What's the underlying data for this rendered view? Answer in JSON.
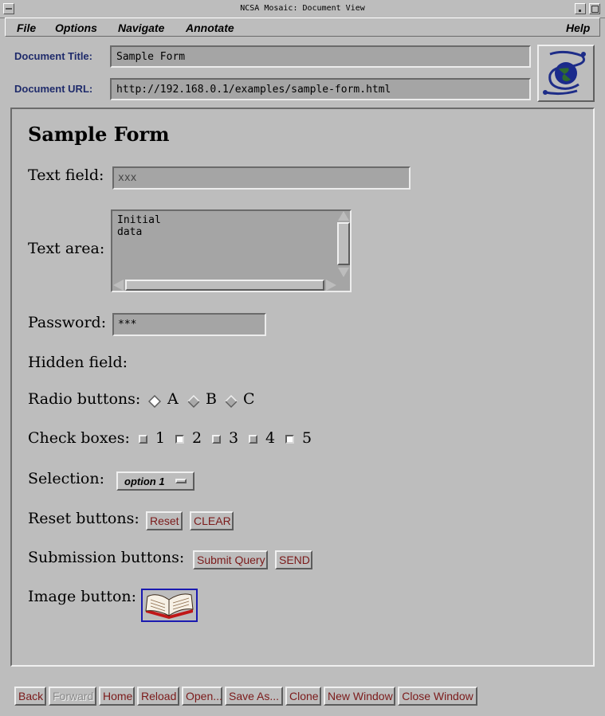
{
  "window": {
    "title": "NCSA Mosaic: Document View"
  },
  "menu": {
    "file": "File",
    "options": "Options",
    "navigate": "Navigate",
    "annotate": "Annotate",
    "help": "Help"
  },
  "doc": {
    "title_label": "Document Title:",
    "title_value": "Sample Form",
    "url_label": "Document URL:",
    "url_value": "http://192.168.0.1/examples/sample-form.html"
  },
  "page": {
    "heading": "Sample Form",
    "text_field": {
      "label": "Text field:",
      "value": "xxx"
    },
    "text_area": {
      "label": "Text area:",
      "line1": "Initial",
      "line2": "data"
    },
    "password": {
      "label": "Password:",
      "value": "***"
    },
    "hidden": {
      "label": "Hidden field:"
    },
    "radio": {
      "label": "Radio buttons:",
      "options": [
        "A",
        "B",
        "C"
      ],
      "selected": "A"
    },
    "checkboxes": {
      "label": "Check boxes:",
      "options": [
        "1",
        "2",
        "3",
        "4",
        "5"
      ],
      "checked": [
        "2",
        "5"
      ]
    },
    "selection": {
      "label": "Selection:",
      "value": "option 1"
    },
    "reset": {
      "label": "Reset buttons:",
      "buttons": [
        "Reset",
        "CLEAR"
      ]
    },
    "submit": {
      "label": "Submission buttons:",
      "buttons": [
        "Submit Query",
        "SEND"
      ]
    },
    "image_button": {
      "label": "Image button:",
      "icon": "open-book-icon"
    }
  },
  "toolbar": {
    "back": "Back",
    "forward": "Forward",
    "home": "Home",
    "reload": "Reload",
    "open": "Open...",
    "save_as": "Save As...",
    "clone": "Clone",
    "new_window": "New Window",
    "close_window": "Close Window"
  },
  "colors": {
    "background": "#bdbdbd",
    "label_blue": "#1f2b6b",
    "button_text": "#7b1a1a",
    "image_border": "#1a1ab0"
  }
}
